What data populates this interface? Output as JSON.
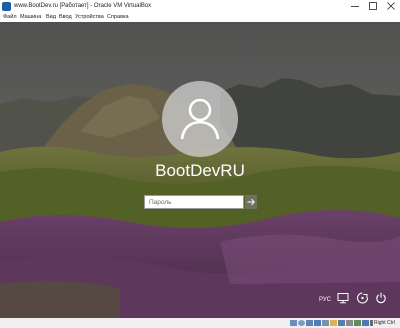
{
  "window": {
    "title": "www.BootDev.ru [Работает] - Oracle VM VirtualBox",
    "app_icon": "virtualbox-icon",
    "controls": [
      "minimize-icon",
      "maximize-icon",
      "close-icon"
    ]
  },
  "menu": {
    "items": [
      "Файл",
      "Машина",
      "Вид",
      "Ввод",
      "Устройства",
      "Справка"
    ]
  },
  "login": {
    "username": "BootDevRU",
    "password_placeholder": "Пароль",
    "avatar_icon": "user-icon",
    "submit_icon": "arrow-right-icon"
  },
  "tray": {
    "language": "РУС",
    "icons": [
      "network-icon",
      "accessibility-icon",
      "power-icon"
    ]
  },
  "statusbar": {
    "icons": [
      "hard-disk-icon",
      "optical-drive-icon",
      "audio-icon",
      "network-adapter-icon",
      "usb-icon",
      "shared-folders-icon",
      "display-icon",
      "video-capture-icon",
      "mouse-integration-icon",
      "keyboard-icon",
      "cpu-icon"
    ],
    "host_key": "Right Ctrl"
  }
}
